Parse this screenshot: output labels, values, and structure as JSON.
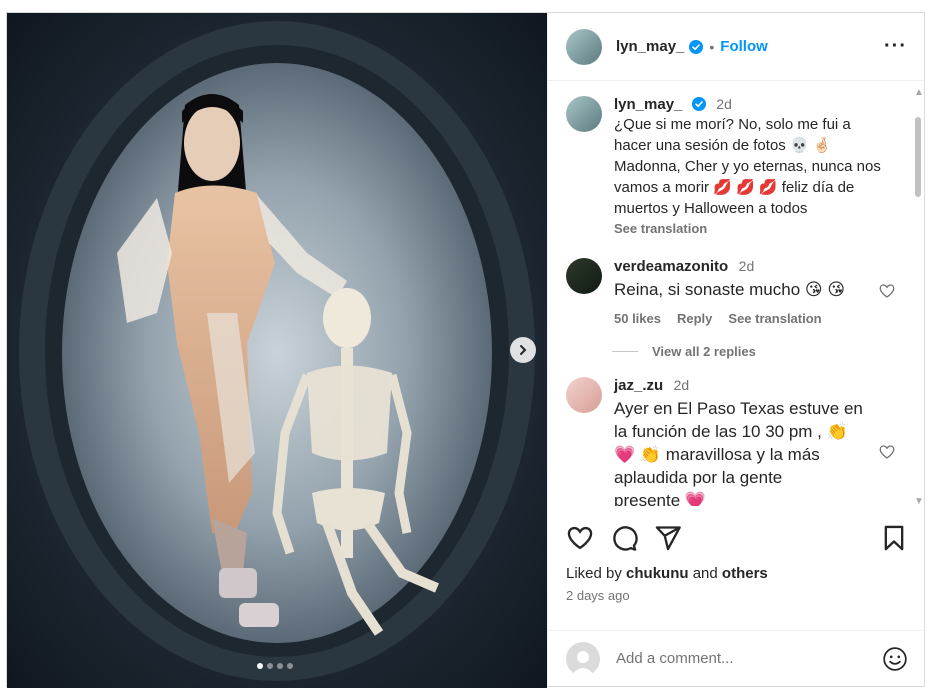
{
  "post": {
    "author": "lyn_may_",
    "follow_label": "Follow",
    "more_icon": "more-horizontal-icon",
    "caption": {
      "username": "lyn_may_",
      "time": "2d",
      "lines": [
        "¿Que si me morí? No, solo me fui a",
        "hacer una sesión de fotos 💀 🤞🏻",
        "Madonna, Cher y yo eternas, nunca nos",
        "vamos a morir 💋 💋 💋  feliz día de",
        "muertos y Halloween a todos"
      ],
      "see_translation": "See translation"
    },
    "comments": [
      {
        "username": "verdeamazonito",
        "time": "2d",
        "text": "Reina, si sonaste mucho 😘 😘",
        "likes": "50 likes",
        "reply": "Reply",
        "see_translation": "See translation",
        "view_replies": "View all 2 replies"
      },
      {
        "username": "jaz_.zu",
        "time": "2d",
        "lines": [
          "Ayer en El Paso Texas estuve en",
          "la función de las 10 30 pm ,  👏",
          "💗 👏 maravillosa y la más",
          "aplaudida por la gente",
          "presente 💗"
        ]
      }
    ],
    "liked_by_prefix": "Liked by ",
    "liked_by_user": "chukunu",
    "liked_by_and": " and ",
    "liked_by_others": "others",
    "posted_ago": "2 days ago",
    "add_comment_placeholder": "Add a comment...",
    "carousel": {
      "count": 4,
      "active_index": 0
    }
  },
  "colors": {
    "accent": "#0095f6",
    "muted": "#737373",
    "text": "#262626"
  }
}
